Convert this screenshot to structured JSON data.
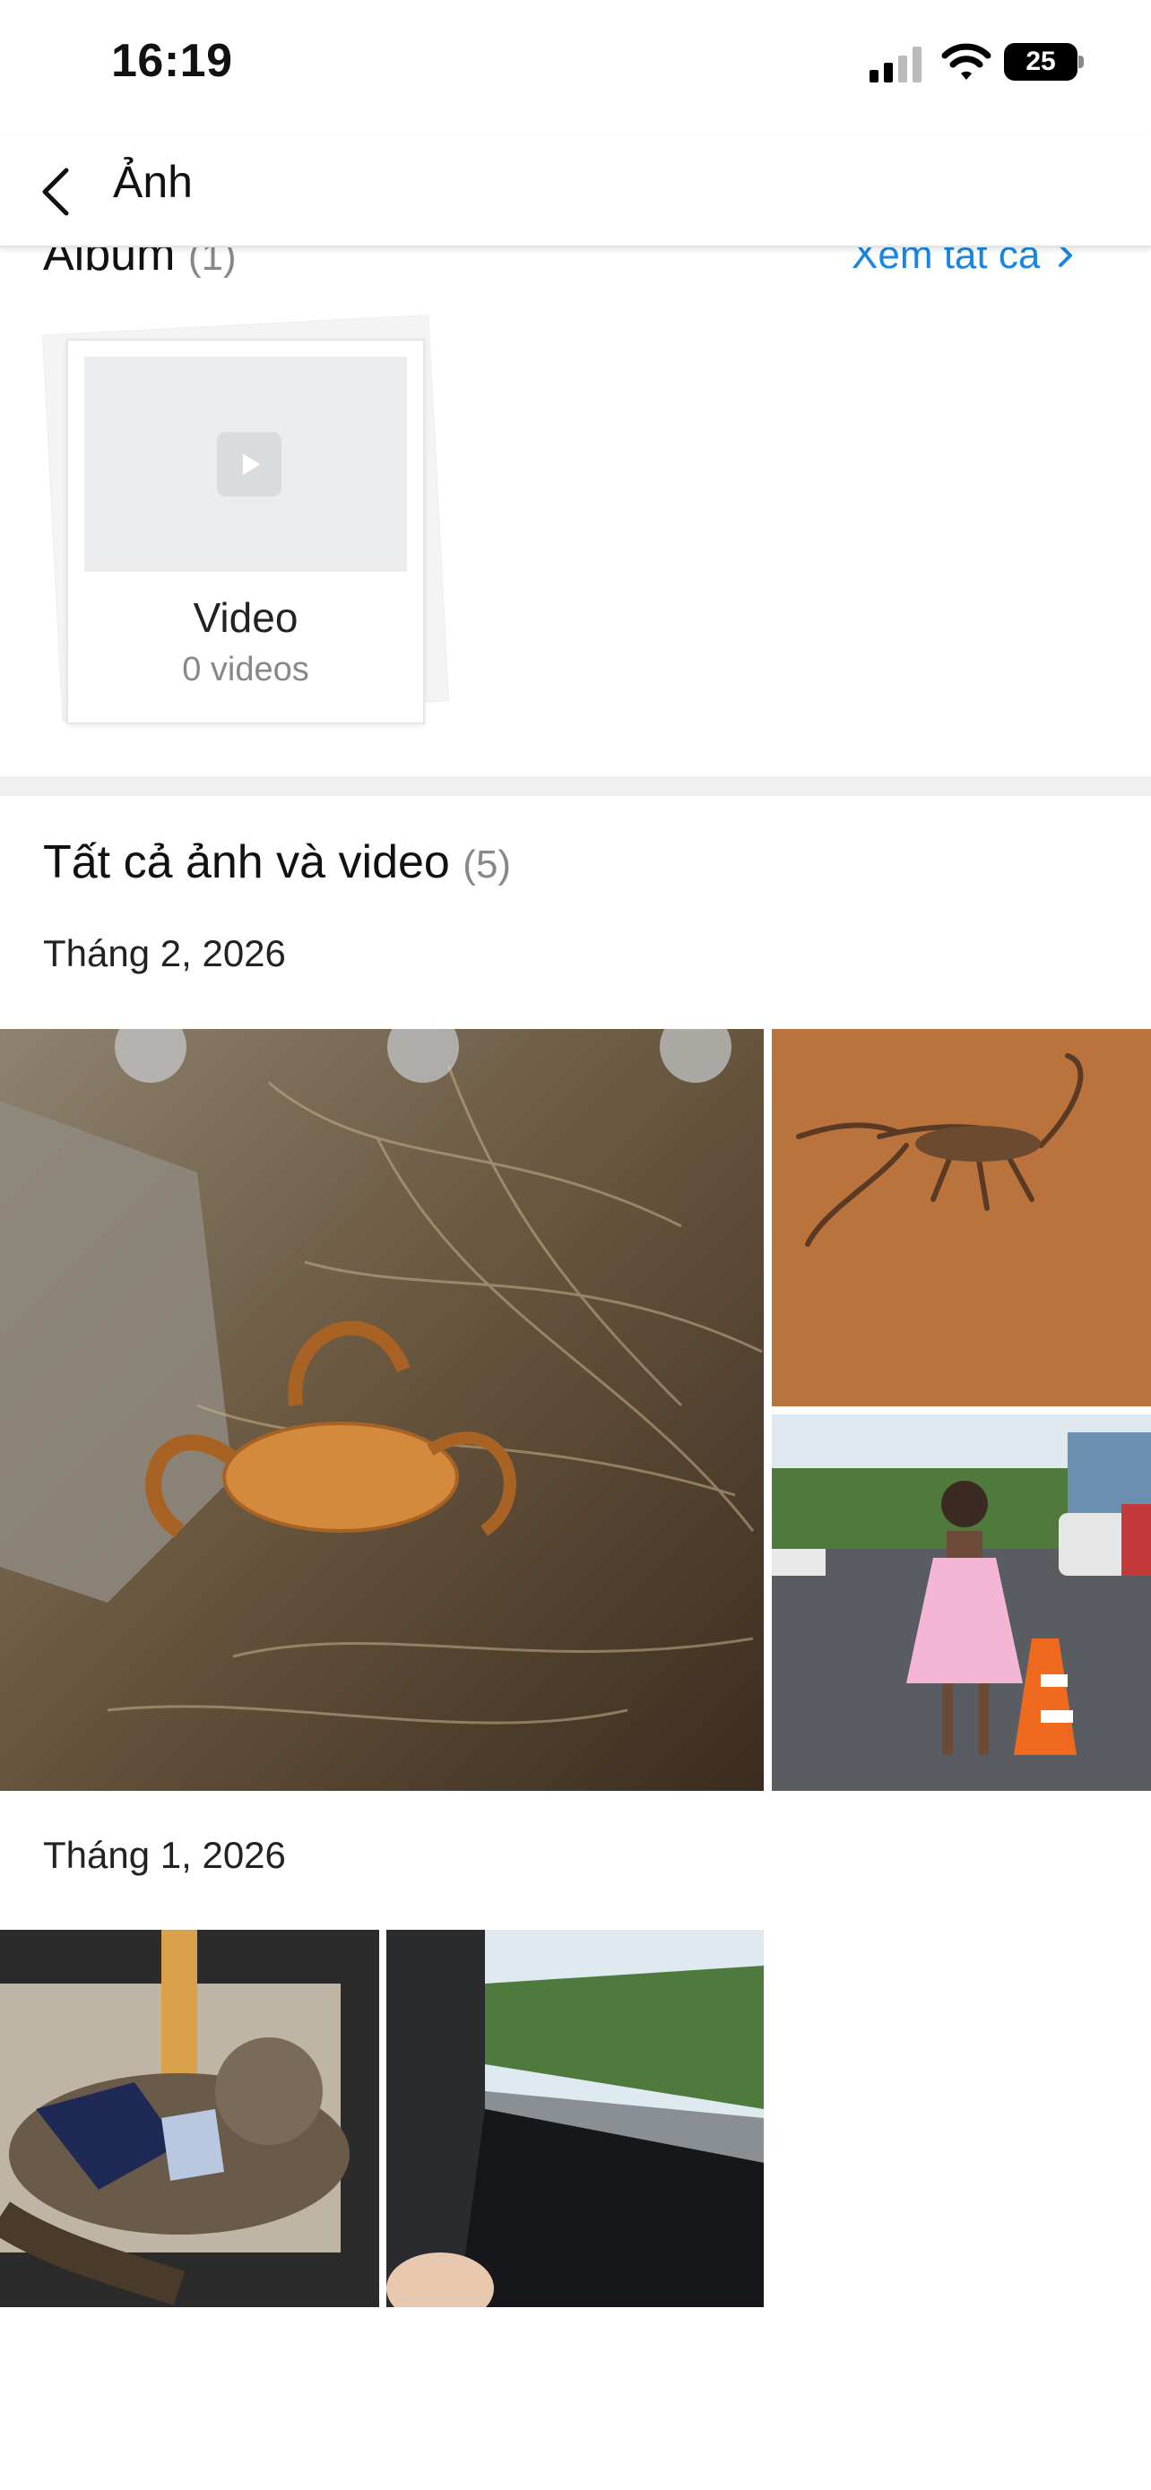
{
  "status_bar": {
    "time": "16:19",
    "battery": "25"
  },
  "nav": {
    "title": "Ảnh"
  },
  "album_section": {
    "title": "Album",
    "count": "(1)",
    "see_all": "Xem tất cả",
    "albums": [
      {
        "name": "Video",
        "subtitle": "0 videos"
      }
    ]
  },
  "all_section": {
    "title": "Tất cả ảnh và video",
    "count": "(5)",
    "groups": [
      {
        "month": "Tháng 2, 2026"
      },
      {
        "month": "Tháng 1, 2026"
      }
    ]
  }
}
